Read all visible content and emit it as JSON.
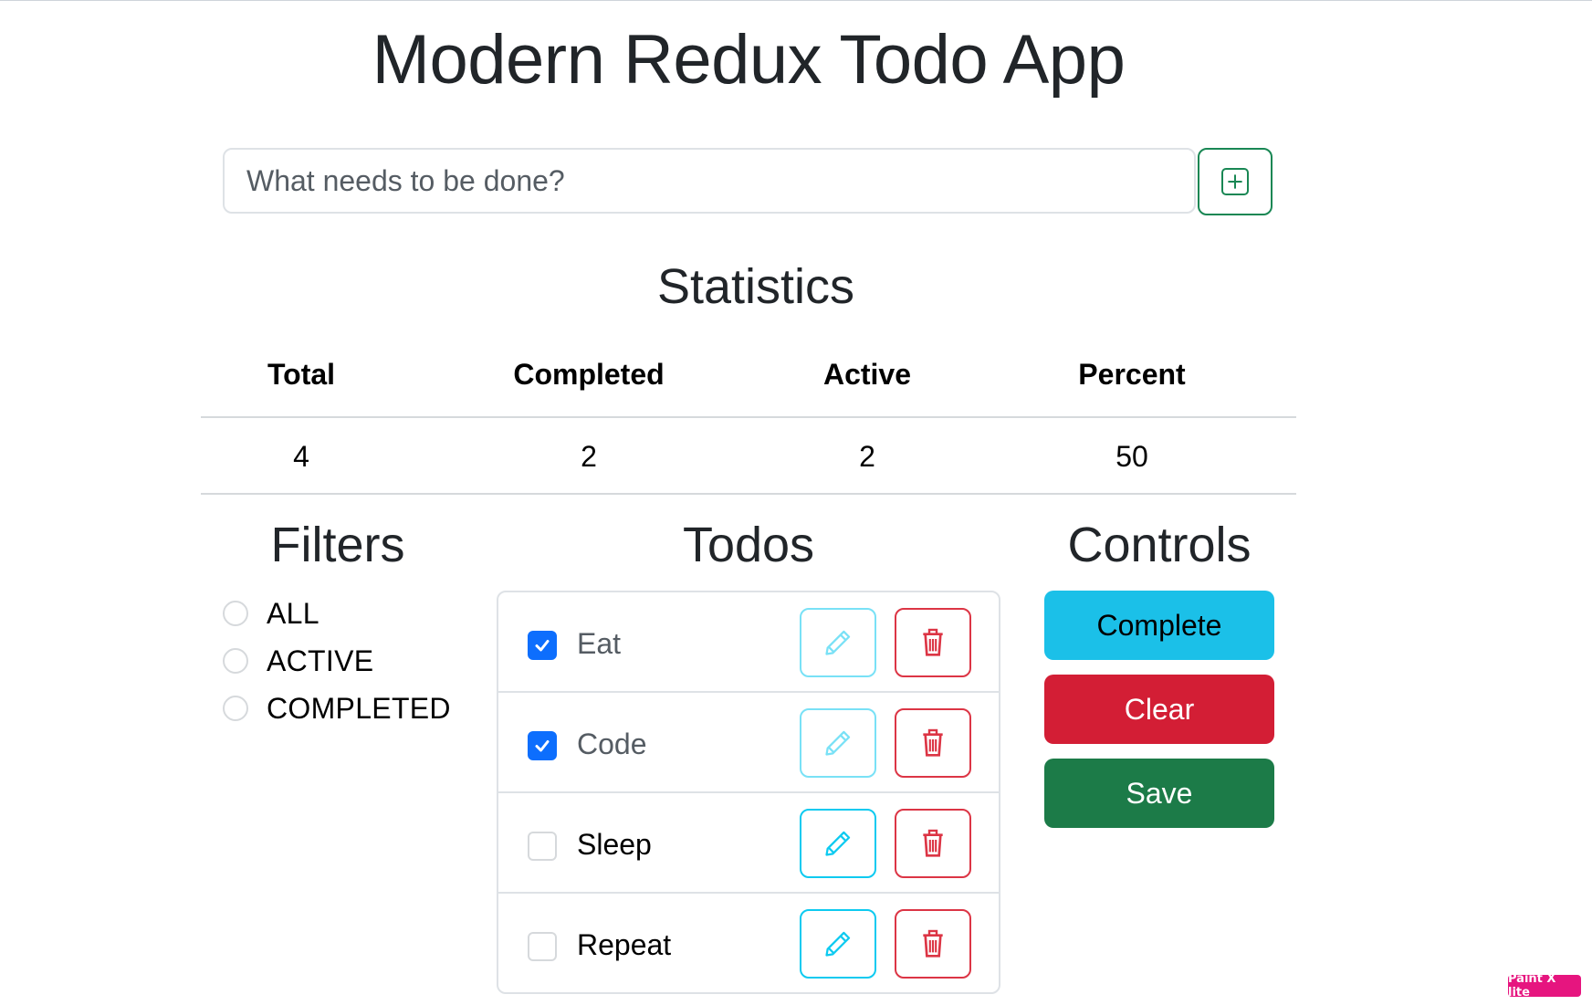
{
  "app": {
    "title": "Modern Redux Todo App",
    "input_placeholder": "What needs to be done?",
    "add_icon": "plus-square-icon"
  },
  "statistics": {
    "title": "Statistics",
    "headers": [
      "Total",
      "Completed",
      "Active",
      "Percent"
    ],
    "values": [
      "4",
      "2",
      "2",
      "50"
    ]
  },
  "filters": {
    "title": "Filters",
    "options": [
      "ALL",
      "ACTIVE",
      "COMPLETED"
    ]
  },
  "todos": {
    "title": "Todos",
    "items": [
      {
        "text": "Eat",
        "completed": true
      },
      {
        "text": "Code",
        "completed": true
      },
      {
        "text": "Sleep",
        "completed": false
      },
      {
        "text": "Repeat",
        "completed": false
      }
    ],
    "edit_icon": "pencil-icon",
    "delete_icon": "trash-icon"
  },
  "controls": {
    "title": "Controls",
    "complete_label": "Complete",
    "clear_label": "Clear",
    "save_label": "Save"
  },
  "colors": {
    "primary": "#0d6efd",
    "info": "#1bc0e8",
    "danger": "#d31e35",
    "success": "#1c7b48"
  },
  "watermark": "Paint X lite"
}
